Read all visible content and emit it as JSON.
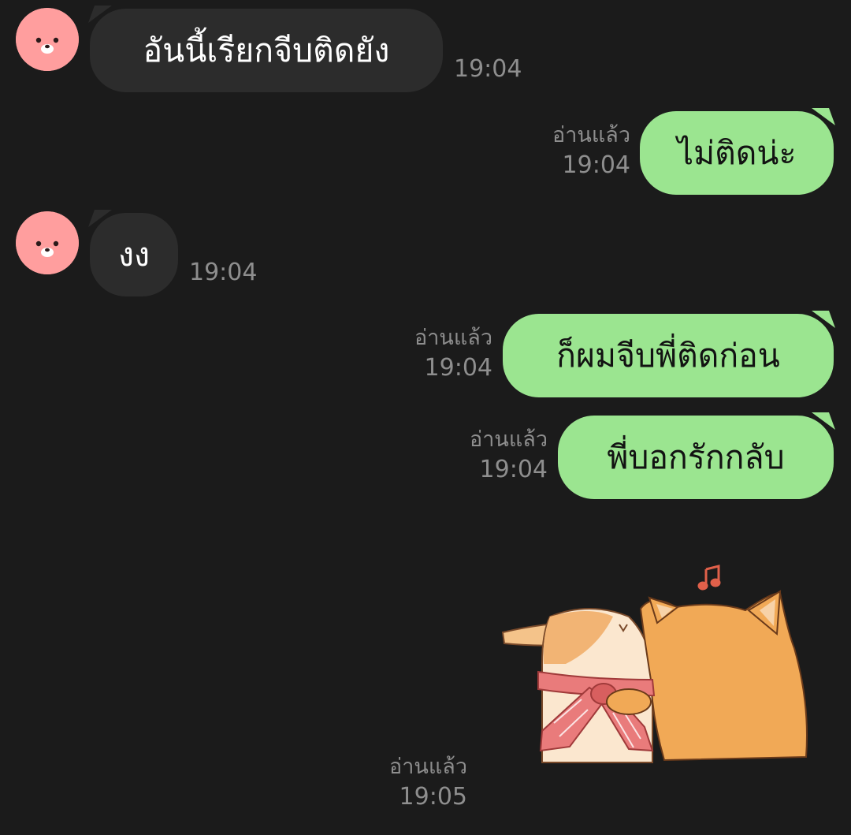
{
  "messages": [
    {
      "direction": "incoming",
      "text": "อันนี้เรียกจีบติดยัง",
      "time": "19:04"
    },
    {
      "direction": "outgoing",
      "text": "ไม่ติดน่ะ",
      "read": "อ่านแล้ว",
      "time": "19:04"
    },
    {
      "direction": "incoming",
      "text": "งง",
      "time": "19:04"
    },
    {
      "direction": "outgoing",
      "text": "ก็ผมจีบพี่ติดก่อน",
      "read": "อ่านแล้ว",
      "time": "19:04"
    },
    {
      "direction": "outgoing",
      "text": "พี่บอกรักกลับ",
      "read": "อ่านแล้ว",
      "time": "19:04"
    },
    {
      "direction": "outgoing",
      "type": "sticker",
      "sticker": "cat-hugging-bunny-sticker",
      "read": "อ่านแล้ว",
      "time": "19:05"
    }
  ],
  "colors": {
    "background": "#1b1b1b",
    "incoming_bubble": "#2c2c2c",
    "outgoing_bubble": "#9be590",
    "meta_text": "#8e8e8e",
    "avatar": "#ff9e9e"
  },
  "icons": {
    "avatar": "pink-bear-avatar-icon"
  }
}
